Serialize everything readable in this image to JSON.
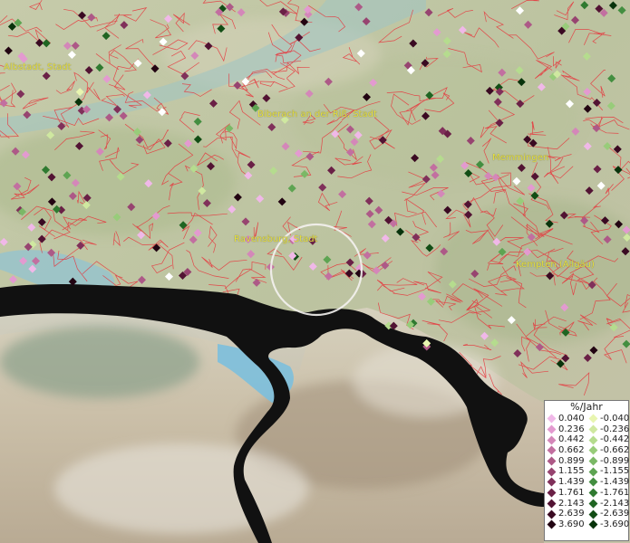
{
  "map": {
    "cities": [
      {
        "name": "Albstadt, Stadt"
      },
      {
        "name": "Biberach an der Riß, Stadt"
      },
      {
        "name": "Memmingen"
      },
      {
        "name": "Ravensburg, Stadt"
      },
      {
        "name": "Kempten (Allgäu)"
      }
    ]
  },
  "legend": {
    "title": "%/Jahr",
    "rows": [
      {
        "pos": "0.040",
        "neg": "-0.040",
        "pos_color": "#f0b8e8",
        "neg_color": "#e8f5b0"
      },
      {
        "pos": "0.236",
        "neg": "-0.236",
        "pos_color": "#e39ad0",
        "neg_color": "#cfe8a0"
      },
      {
        "pos": "0.442",
        "neg": "-0.442",
        "pos_color": "#d487b9",
        "neg_color": "#b5dc8e"
      },
      {
        "pos": "0.662",
        "neg": "-0.662",
        "pos_color": "#c26fa0",
        "neg_color": "#98cc7a"
      },
      {
        "pos": "0.899",
        "neg": "-0.899",
        "pos_color": "#ad5987",
        "neg_color": "#7bb866"
      },
      {
        "pos": "1.155",
        "neg": "-1.155",
        "pos_color": "#974470",
        "neg_color": "#5ea452"
      },
      {
        "pos": "1.439",
        "neg": "-1.439",
        "pos_color": "#80305a",
        "neg_color": "#438e40"
      },
      {
        "pos": "1.761",
        "neg": "-1.761",
        "pos_color": "#6a2046",
        "neg_color": "#2f7a30"
      },
      {
        "pos": "2.143",
        "neg": "-2.143",
        "pos_color": "#521333",
        "neg_color": "#1f6522"
      },
      {
        "pos": "2.639",
        "neg": "-2.639",
        "pos_color": "#3a0a22",
        "neg_color": "#124d15"
      },
      {
        "pos": "3.690",
        "neg": "-3.690",
        "pos_color": "#220412",
        "neg_color": "#08330b"
      }
    ]
  }
}
